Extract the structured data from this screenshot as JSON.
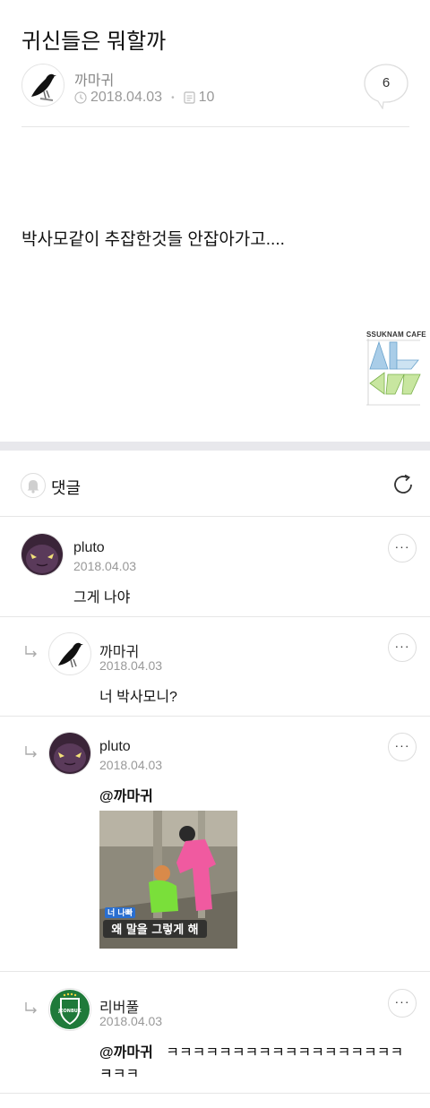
{
  "post": {
    "title": "귀신들은 뭐할까",
    "author": "까마귀",
    "date": "2018.04.03",
    "views": "10",
    "comment_count": "6",
    "body": "박사모같이 추잡한것들 안잡아가고....",
    "logo_text": "SSUKNAM CAFE"
  },
  "comments_section": {
    "label": "댓글"
  },
  "comments": [
    {
      "author": "pluto",
      "date": "2018.04.03",
      "text": "그게 나야",
      "more": "···"
    },
    {
      "author": "까마귀",
      "date": "2018.04.03",
      "text": "너 박사모니?",
      "more": "···"
    },
    {
      "author": "pluto",
      "date": "2018.04.03",
      "mention": "@까마귀",
      "text": "",
      "more": "···",
      "image_caption_top": "너 나빠",
      "image_caption": "왜 말을 그렇게 해"
    },
    {
      "author": "리버풀",
      "date": "2018.04.03",
      "mention": "@까마귀",
      "text": "ㅋㅋㅋㅋㅋㅋㅋㅋㅋㅋㅋㅋㅋㅋㅋㅋㅋㅋㅋ",
      "text2": "ㅋㅋㅋ",
      "more": "···",
      "badge_text": "JEONBUK"
    }
  ]
}
